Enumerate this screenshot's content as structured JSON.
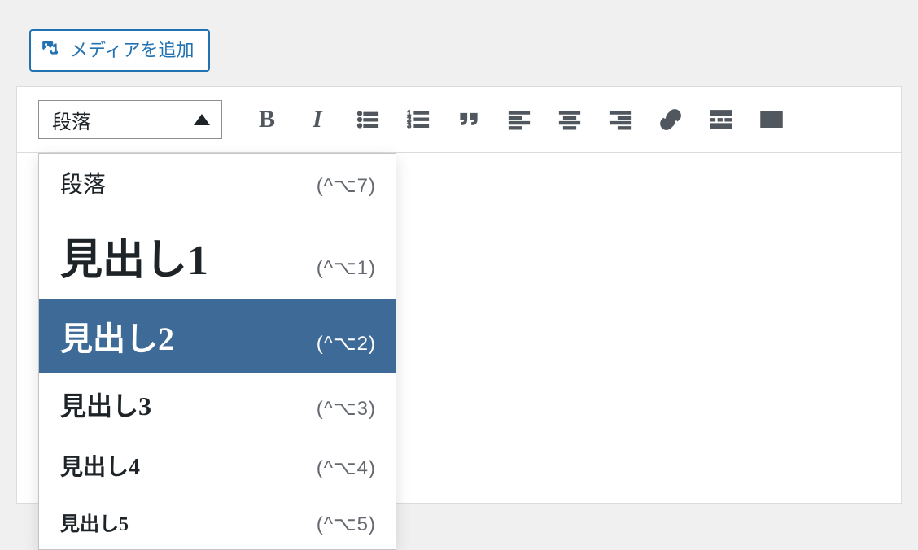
{
  "media": {
    "add_media_label": "メディアを追加"
  },
  "toolbar": {
    "format_current": "段落"
  },
  "format_dropdown": {
    "items": [
      {
        "label": "段落",
        "shortcut": "(^⌥7)",
        "style": "p-style",
        "selected": false
      },
      {
        "label": "見出し1",
        "shortcut": "(^⌥1)",
        "style": "h1-style",
        "selected": false
      },
      {
        "label": "見出し2",
        "shortcut": "(^⌥2)",
        "style": "h2-style",
        "selected": true
      },
      {
        "label": "見出し3",
        "shortcut": "(^⌥3)",
        "style": "h3-style",
        "selected": false
      },
      {
        "label": "見出し4",
        "shortcut": "(^⌥4)",
        "style": "h4-style",
        "selected": false
      },
      {
        "label": "見出し5",
        "shortcut": "(^⌥5)",
        "style": "h5-style",
        "selected": false
      }
    ]
  },
  "icons": {
    "media": "media-icon",
    "bold": "B",
    "italic": "I"
  }
}
